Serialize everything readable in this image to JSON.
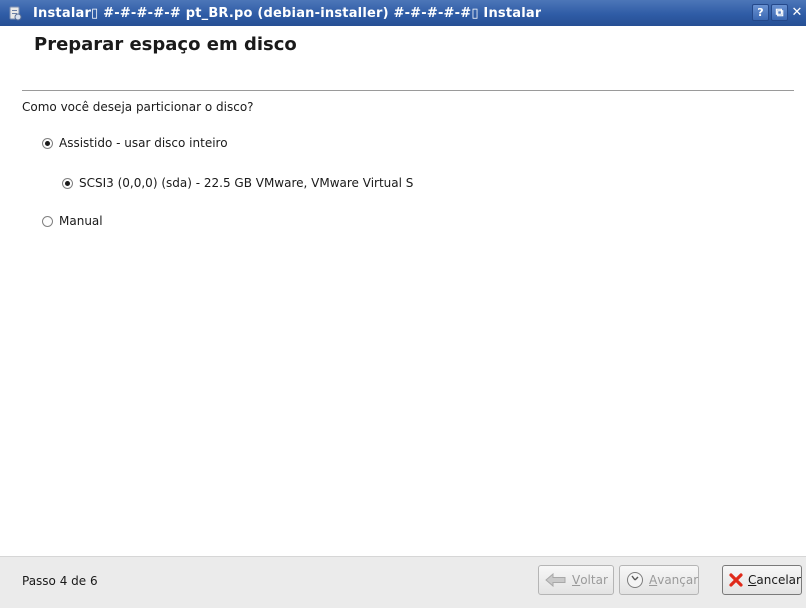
{
  "window": {
    "title": "Instalar▯ #-#-#-#-#  pt_BR.po (debian-installer)  #-#-#-#-#▯ Instalar",
    "help_label": "?",
    "restore_label": "⧉",
    "close_label": "✕"
  },
  "page": {
    "title": "Preparar espaço em disco",
    "question": "Como você deseja particionar o disco?"
  },
  "options": [
    {
      "label": "Assistido - usar disco inteiro",
      "selected": true
    },
    {
      "label": "SCSI3 (0,0,0) (sda) - 22.5 GB VMware, VMware Virtual S",
      "selected": true
    },
    {
      "label": "Manual",
      "selected": false
    }
  ],
  "footer": {
    "step": "Passo 4 de 6",
    "back": {
      "mnemonic": "V",
      "rest": "oltar",
      "enabled": false
    },
    "next": {
      "mnemonic": "A",
      "rest": "vançar",
      "enabled": false
    },
    "cancel": {
      "mnemonic": "C",
      "rest": "ancelar",
      "enabled": true
    }
  },
  "colors": {
    "titlebar": "#2f5ca6",
    "cancel_icon": "#e02a1a"
  }
}
